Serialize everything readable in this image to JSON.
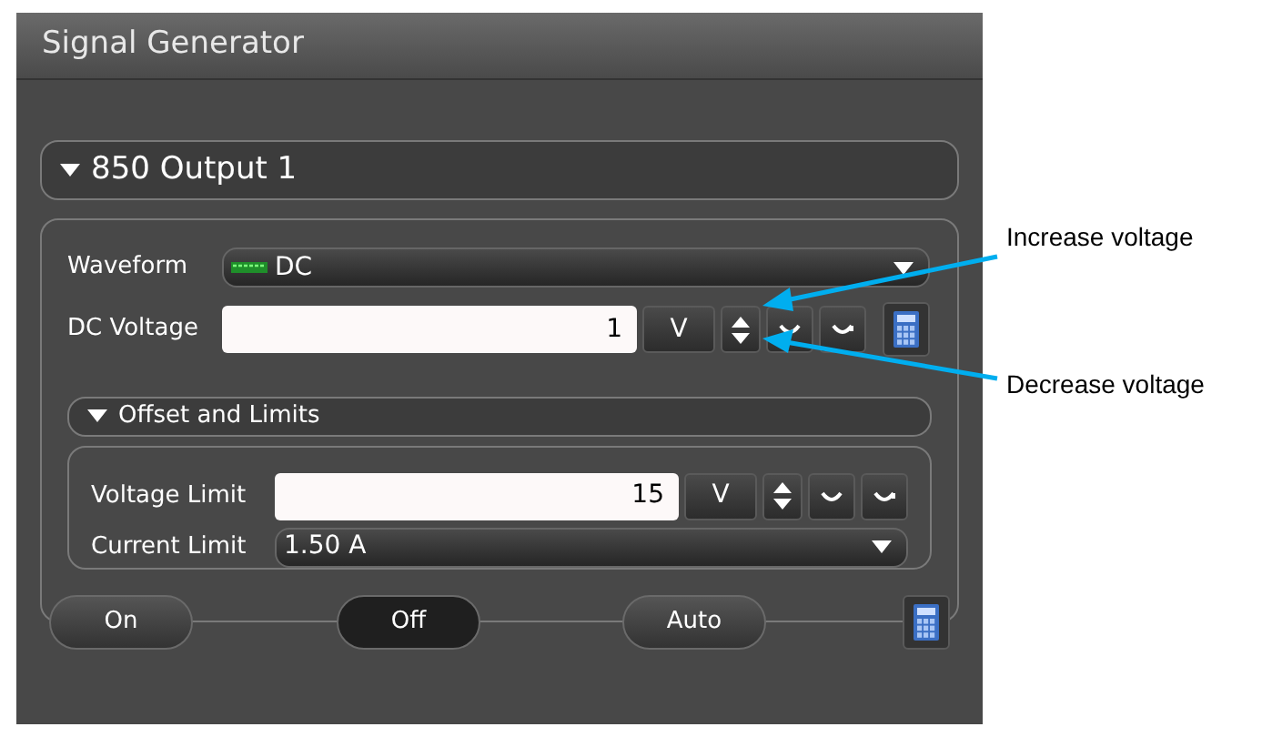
{
  "window": {
    "title": "Signal Generator"
  },
  "output": {
    "label": "850 Output 1",
    "expanded": true
  },
  "waveform": {
    "label": "Waveform",
    "value": "DC"
  },
  "dc_voltage": {
    "label": "DC Voltage",
    "value": "1",
    "unit": "V"
  },
  "offset_section": {
    "label": "Offset and Limits",
    "expanded": true
  },
  "voltage_limit": {
    "label": "Voltage Limit",
    "value": "15",
    "unit": "V"
  },
  "current_limit": {
    "label": "Current Limit",
    "value": "1.50 A"
  },
  "buttons": [
    {
      "label": "On",
      "selected": false
    },
    {
      "label": "Off",
      "selected": true
    },
    {
      "label": "Auto",
      "selected": false
    }
  ],
  "callouts": [
    "Increase voltage",
    "Decrease voltage"
  ]
}
